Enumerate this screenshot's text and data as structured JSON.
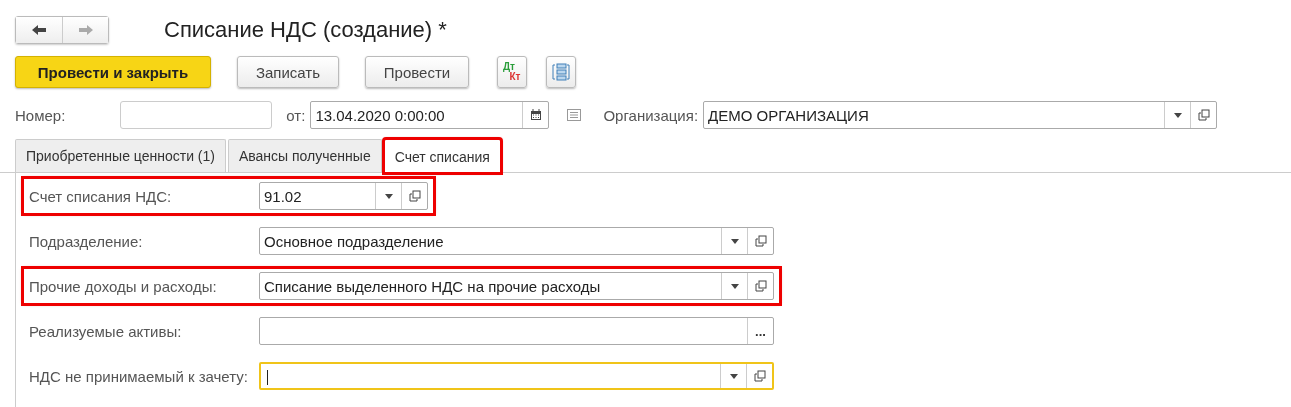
{
  "window": {
    "title": "Списание НДС (создание) *"
  },
  "commands": [
    {
      "label": "Провести и закрыть",
      "kind": "primary"
    },
    {
      "label": "Записать",
      "kind": "normal"
    },
    {
      "label": "Провести",
      "kind": "normal"
    },
    {
      "kind": "dtkt",
      "dt": "Дт",
      "kt": "Кт"
    },
    {
      "kind": "structure"
    }
  ],
  "header": {
    "number_label": "Номер:",
    "date_label": "от:",
    "date_value": "13.04.2020  0:00:00",
    "org_label": "Организация:",
    "org_value": "ДЕМО ОРГАНИЗАЦИЯ"
  },
  "tabs": [
    {
      "label": "Приобретенные ценности (1)",
      "selected": false,
      "highlighted": false
    },
    {
      "label": "Авансы полученные",
      "selected": false,
      "highlighted": false
    },
    {
      "label": "Счет списания",
      "selected": true,
      "highlighted": true
    }
  ],
  "fields": [
    {
      "label": "Счет списания НДС:",
      "value": "91.02",
      "kind": "short_dropdown",
      "highlighted": true,
      "focused": false
    },
    {
      "label": "Подразделение:",
      "value": "Основное подразделение",
      "kind": "dropdown",
      "highlighted": false,
      "focused": false
    },
    {
      "label": "Прочие доходы и расходы:",
      "value": "Списание выделенного НДС на прочие расходы",
      "kind": "dropdown",
      "highlighted": true,
      "focused": false
    },
    {
      "label": "Реализуемые активы:",
      "kind": "select",
      "button": "...",
      "highlighted": false,
      "focused": false
    },
    {
      "label": "НДС не принимаемый к зачету:",
      "kind": "dropdown",
      "highlighted": false,
      "focused": true
    }
  ]
}
